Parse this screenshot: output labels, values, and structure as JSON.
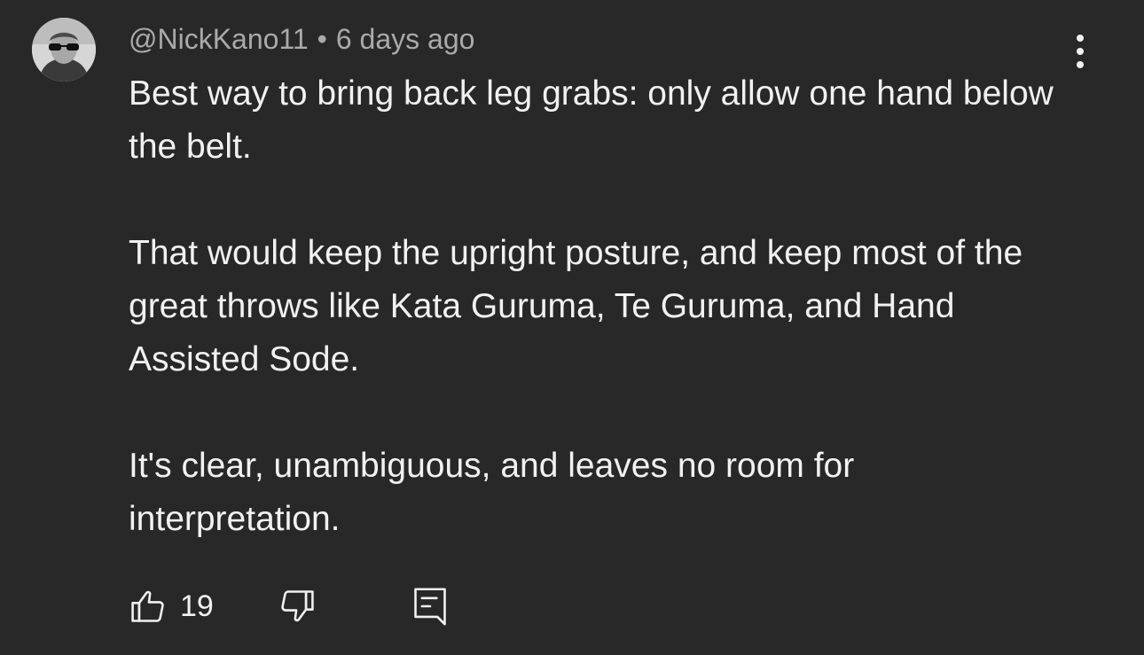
{
  "comment": {
    "author": "@NickKano11",
    "separator": "•",
    "time": "6 days ago",
    "paragraphs": [
      "Best way to bring back leg grabs: only allow one hand below the belt.",
      "That would keep the upright posture, and keep most of the great throws like Kata Guruma, Te Guruma, and Hand Assisted Sode.",
      "It's clear, unambiguous, and leaves no room for interpretation."
    ],
    "like_count": "19"
  },
  "icons": {
    "avatar": "user-avatar",
    "menu": "more-vert-icon",
    "like": "thumbs-up-icon",
    "dislike": "thumbs-down-icon",
    "reply": "reply-comment-icon"
  },
  "colors": {
    "background": "#282828",
    "text": "#f1f1f1",
    "meta_text": "#aaaaaa"
  }
}
